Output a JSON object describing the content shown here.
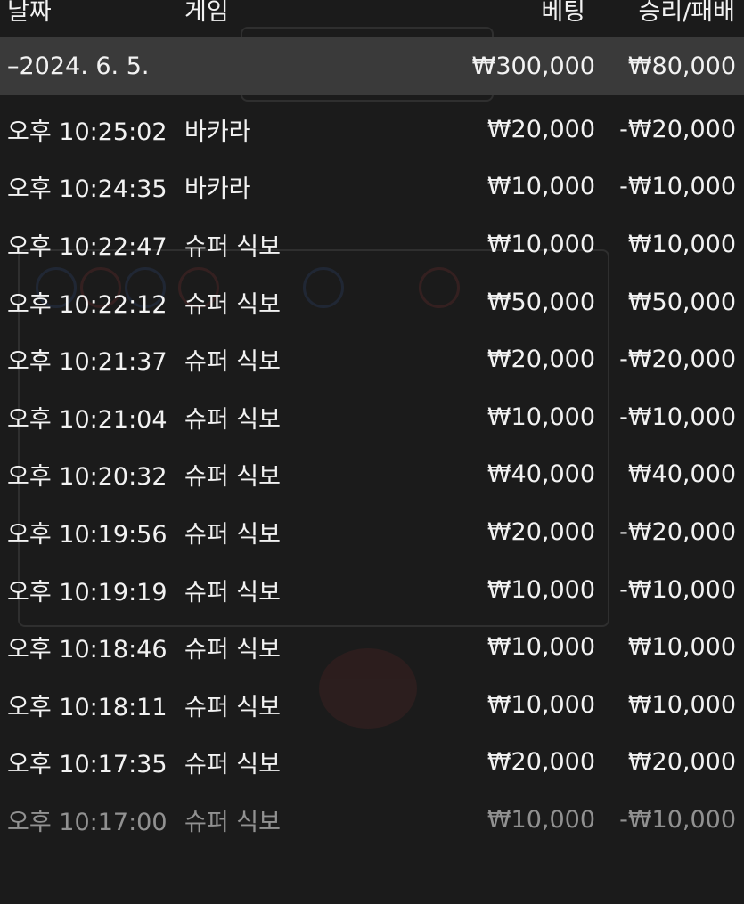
{
  "header": {
    "date": "날짜",
    "game": "게임",
    "bet": "베팅",
    "result": "승리/패배"
  },
  "date_group": {
    "date": "–2024. 6. 5.",
    "bet": "₩300,000",
    "result": "₩80,000"
  },
  "rows": [
    {
      "time": "오후 10:25:02",
      "game": "바카라",
      "bet": "₩20,000",
      "result": "-₩20,000"
    },
    {
      "time": "오후 10:24:35",
      "game": "바카라",
      "bet": "₩10,000",
      "result": "-₩10,000"
    },
    {
      "time": "오후 10:22:47",
      "game": "슈퍼 식보",
      "bet": "₩10,000",
      "result": "₩10,000"
    },
    {
      "time": "오후 10:22:12",
      "game": "슈퍼 식보",
      "bet": "₩50,000",
      "result": "₩50,000"
    },
    {
      "time": "오후 10:21:37",
      "game": "슈퍼 식보",
      "bet": "₩20,000",
      "result": "-₩20,000"
    },
    {
      "time": "오후 10:21:04",
      "game": "슈퍼 식보",
      "bet": "₩10,000",
      "result": "-₩10,000"
    },
    {
      "time": "오후 10:20:32",
      "game": "슈퍼 식보",
      "bet": "₩40,000",
      "result": "₩40,000"
    },
    {
      "time": "오후 10:19:56",
      "game": "슈퍼 식보",
      "bet": "₩20,000",
      "result": "-₩20,000"
    },
    {
      "time": "오후 10:19:19",
      "game": "슈퍼 식보",
      "bet": "₩10,000",
      "result": "-₩10,000"
    },
    {
      "time": "오후 10:18:46",
      "game": "슈퍼 식보",
      "bet": "₩10,000",
      "result": "₩10,000"
    },
    {
      "time": "오후 10:18:11",
      "game": "슈퍼 식보",
      "bet": "₩10,000",
      "result": "₩10,000"
    },
    {
      "time": "오후 10:17:35",
      "game": "슈퍼 식보",
      "bet": "₩20,000",
      "result": "₩20,000"
    },
    {
      "time": "오후 10:17:00",
      "game": "슈퍼 식보",
      "bet": "₩10,000",
      "result": "-₩10,000"
    }
  ]
}
